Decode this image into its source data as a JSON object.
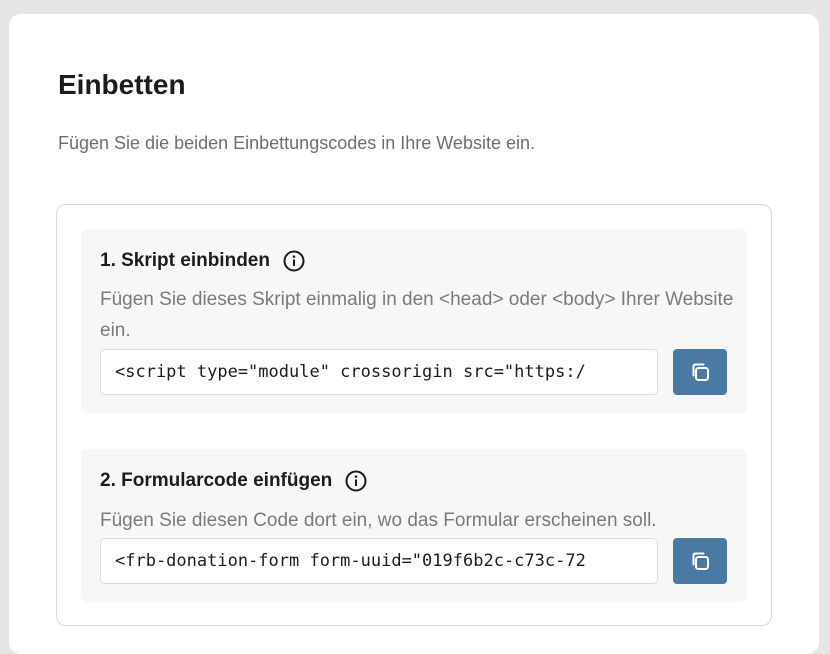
{
  "page": {
    "title": "Einbetten",
    "subtitle": "Fügen Sie die beiden Einbettungscodes in Ihre Website ein."
  },
  "sections": [
    {
      "title": "1. Skript einbinden",
      "info_icon": "info-circle-icon",
      "description": "Fügen Sie dieses Skript einmalig in den <head> oder <body> Ihrer Website ein.",
      "code": "<script type=\"module\" crossorigin src=\"https:/",
      "copy_icon": "copy-icon"
    },
    {
      "title": "2. Formularcode einfügen",
      "info_icon": "info-circle-icon",
      "description": "Fügen Sie diesen Code dort ein, wo das Formular erscheinen soll.",
      "code": "<frb-donation-form form-uuid=\"019f6b2c-c73c-72",
      "copy_icon": "copy-icon"
    }
  ],
  "colors": {
    "button": "#4a7aa3",
    "section_background": "#f7f7f7",
    "muted_text": "#7a7a7a"
  }
}
